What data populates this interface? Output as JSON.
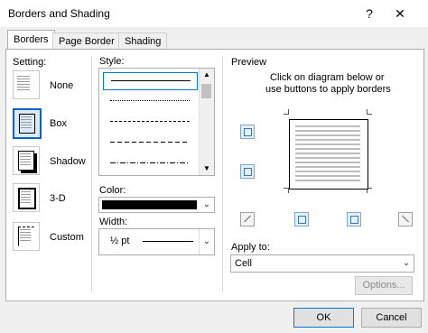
{
  "dialog": {
    "title": "Borders and Shading",
    "help_icon": "?",
    "close_icon": "✕"
  },
  "tabs": [
    {
      "label": "Borders",
      "active": true
    },
    {
      "label": "Page Border",
      "active": false
    },
    {
      "label": "Shading",
      "active": false
    }
  ],
  "setting": {
    "header": "Setting:",
    "items": [
      {
        "label": "None",
        "selected": false
      },
      {
        "label": "Box",
        "selected": true
      },
      {
        "label": "Shadow",
        "selected": false
      },
      {
        "label": "3-D",
        "selected": false
      },
      {
        "label": "Custom",
        "selected": false
      }
    ]
  },
  "style": {
    "header": "Style:",
    "items": [
      "solid",
      "dotted",
      "dashed-short",
      "dashed",
      "dash-dot"
    ]
  },
  "color": {
    "label": "Color:",
    "value": "#000000"
  },
  "width": {
    "label": "Width:",
    "value": "½ pt"
  },
  "preview": {
    "header": "Preview",
    "instruction_line1": "Click on diagram below or",
    "instruction_line2": "use buttons to apply borders"
  },
  "apply_to": {
    "label": "Apply to:",
    "value": "Cell"
  },
  "buttons": {
    "options": "Options...",
    "ok": "OK",
    "cancel": "Cancel"
  },
  "colors": {
    "accent": "#0078d7",
    "selection_bg": "#dce9f7"
  }
}
